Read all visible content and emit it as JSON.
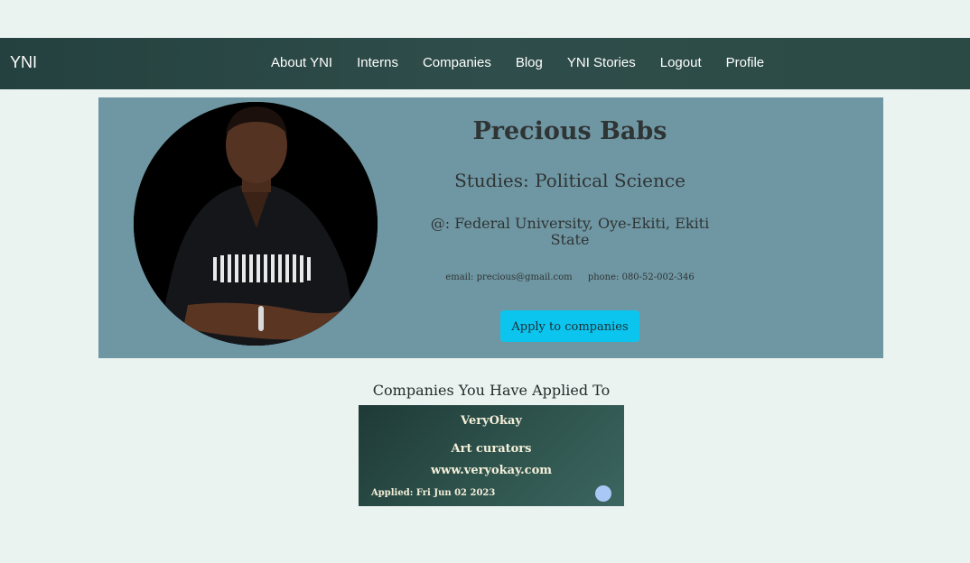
{
  "navbar": {
    "brand": "YNI",
    "links": [
      "About YNI",
      "Interns",
      "Companies",
      "Blog",
      "YNI Stories",
      "Logout",
      "Profile"
    ]
  },
  "profile": {
    "name": "Precious Babs",
    "studies": "Studies: Political Science",
    "school": "@: Federal University, Oye-Ekiti, Ekiti State",
    "email": "email: precious@gmail.com",
    "phone": "phone: 080-52-002-346",
    "apply_button": "Apply to companies",
    "avatar_icon": "person-photo-icon"
  },
  "applied": {
    "heading": "Companies You Have Applied To",
    "companies": [
      {
        "name": "VeryOkay",
        "description": "Art curators",
        "website": "www.veryokay.com",
        "applied": "Applied: Fri Jun 02 2023"
      }
    ]
  },
  "colors": {
    "navbar": "#2a4743",
    "profile_card": "#6f97a3",
    "apply_button": "#0cc5ef",
    "company_card": "#2c4f49",
    "page_background": "#ebf3f1"
  }
}
